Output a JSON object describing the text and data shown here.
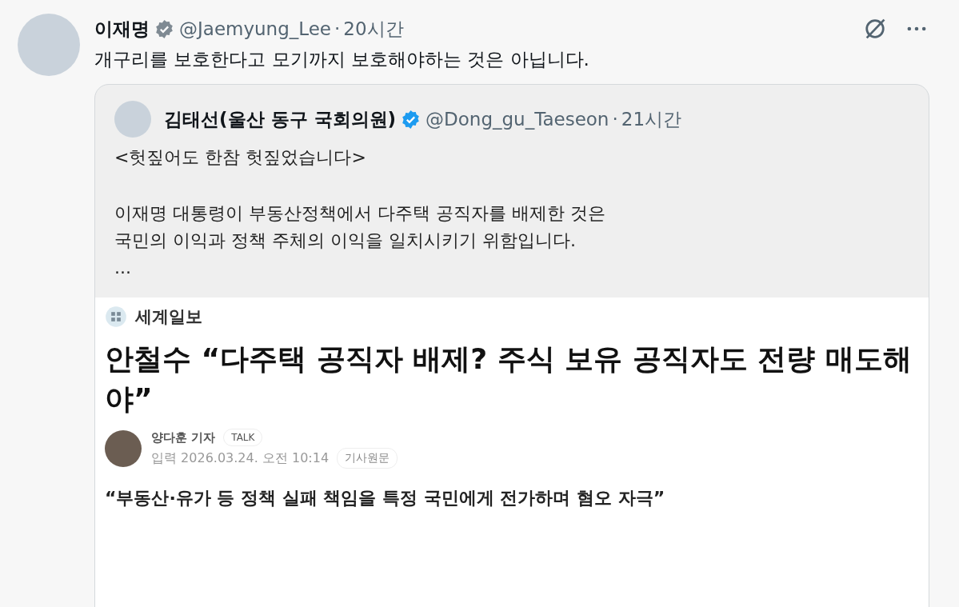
{
  "post": {
    "author": "이재명",
    "handle": "@Jaemyung_Lee",
    "separator": "·",
    "time": "20시간",
    "text": "개구리를 보호한다고 모기까지 보호해야하는 것은 아닙니다."
  },
  "quote": {
    "author": "김태선(울산 동구 국회의원)",
    "handle": "@Dong_gu_Taeseon",
    "separator": "·",
    "time": "21시간",
    "paragraphs": [
      [
        "<헛짚어도 한참 헛짚었습니다>"
      ],
      [
        "이재명 대통령이 부동산정책에서 다주택 공직자를 배제한 것은",
        "국민의 이익과 정책 주체의 이익을 일치시키기 위함입니다.",
        "..."
      ]
    ]
  },
  "article": {
    "source": "세계일보",
    "headline": "안철수 “다주택 공직자 배제? 주식 보유 공직자도 전량 매도해야”",
    "reporter": "양다훈 기자",
    "tag": "TALK",
    "date": "입력 2026.03.24. 오전 10:14",
    "original_button": "기사원문",
    "subheadline": "“부동산·유가 등 정책 실패 책임을 특정 국민에게 전가하며 혐오 자극”"
  }
}
